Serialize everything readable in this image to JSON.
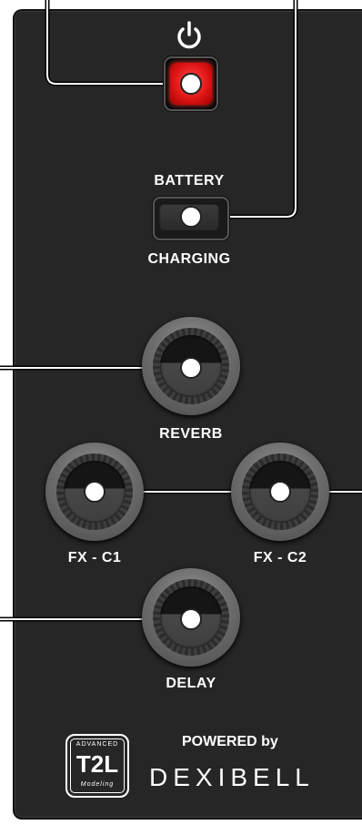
{
  "power": {
    "icon": "power-icon",
    "led_color": "#e01616",
    "state": "on"
  },
  "battery": {
    "label_top": "BATTERY",
    "label_bottom": "CHARGING"
  },
  "knobs": {
    "reverb": "REVERB",
    "fx_c1": "FX - C1",
    "fx_c2": "FX - C2",
    "delay": "DELAY"
  },
  "branding": {
    "logo_small_top": "ADVANCED",
    "logo_big": "T2L",
    "logo_small_bottom": "Modeling",
    "powered_by": "POWERED by",
    "brand_name": "DEXIBELL"
  }
}
